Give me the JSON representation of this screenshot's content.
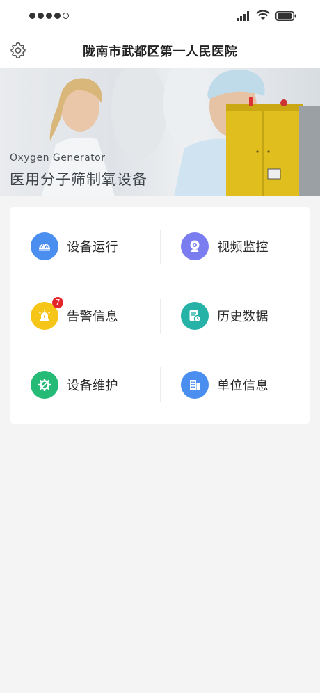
{
  "header": {
    "title": "陇南市武都区第一人民医院"
  },
  "banner": {
    "subtitle": "Oxygen Generator",
    "title": "医用分子筛制氧设备"
  },
  "menu": {
    "items": [
      {
        "label": "设备运行",
        "color": "#4a8ef0",
        "icon": "dashboard-icon"
      },
      {
        "label": "视频监控",
        "color": "#7a7df0",
        "icon": "camera-icon"
      },
      {
        "label": "告警信息",
        "color": "#f5c518",
        "icon": "alarm-icon",
        "badge": "7"
      },
      {
        "label": "历史数据",
        "color": "#27b2a8",
        "icon": "history-icon"
      },
      {
        "label": "设备维护",
        "color": "#25ba75",
        "icon": "maintenance-icon"
      },
      {
        "label": "单位信息",
        "color": "#4a8ef0",
        "icon": "building-icon"
      }
    ]
  },
  "colors": {
    "background": "#f4f4f5",
    "badge": "#e4252c",
    "device": "#e0be1e"
  }
}
